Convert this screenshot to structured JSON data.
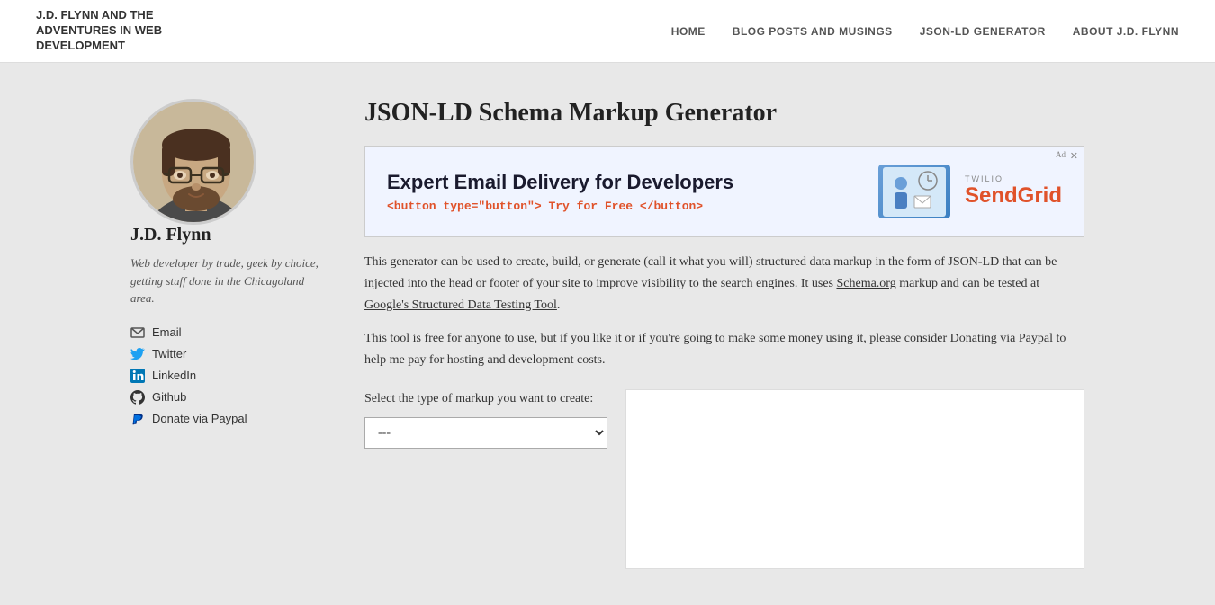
{
  "site": {
    "title": "J.D. FLYNN AND THE ADVENTURES IN WEB DEVELOPMENT"
  },
  "nav": {
    "items": [
      {
        "label": "HOME",
        "href": "#"
      },
      {
        "label": "BLOG POSTS AND MUSINGS",
        "href": "#"
      },
      {
        "label": "JSON-LD GENERATOR",
        "href": "#"
      },
      {
        "label": "ABOUT J.D. FLYNN",
        "href": "#"
      }
    ]
  },
  "sidebar": {
    "name": "J.D. Flynn",
    "bio": "Web developer by trade, geek by choice, getting stuff done in the Chicagoland area.",
    "links": [
      {
        "id": "email",
        "label": "Email",
        "icon": "email-icon"
      },
      {
        "id": "twitter",
        "label": "Twitter",
        "icon": "twitter-icon"
      },
      {
        "id": "linkedin",
        "label": "LinkedIn",
        "icon": "linkedin-icon"
      },
      {
        "id": "github",
        "label": "Github",
        "icon": "github-icon"
      },
      {
        "id": "paypal",
        "label": "Donate via Paypal",
        "icon": "paypal-icon"
      }
    ]
  },
  "main": {
    "page_title": "JSON-LD Schema Markup Generator",
    "ad": {
      "headline": "Expert Email Delivery for Developers",
      "button_code": "<button type=\"button\">",
      "try_label": "Try for Free",
      "button_code_end": "</button>",
      "badge": "Ad",
      "brand_sub": "TWILIO",
      "brand_name": "Send",
      "brand_name_highlight": "Grid"
    },
    "description1": "This generator can be used to create, build, or generate (call it what you will) structured data markup in the form of JSON-LD that can be injected into the head or footer of your site to improve visibility to the search engines. It uses Schema.org markup and can be tested at Google's Structured Data Testing Tool.",
    "description2": "This tool is free for anyone to use, but if you like it or if you're going to make some money using it, please consider Donating via Paypal to help me pay for hosting and development costs.",
    "schema_link": "Schema.org",
    "google_link": "Google's Structured Data Testing Tool",
    "donate_link": "Donating via Paypal",
    "form": {
      "label": "Select the type of markup you want to create:",
      "select_default": "---",
      "select_placeholder": "---"
    }
  }
}
